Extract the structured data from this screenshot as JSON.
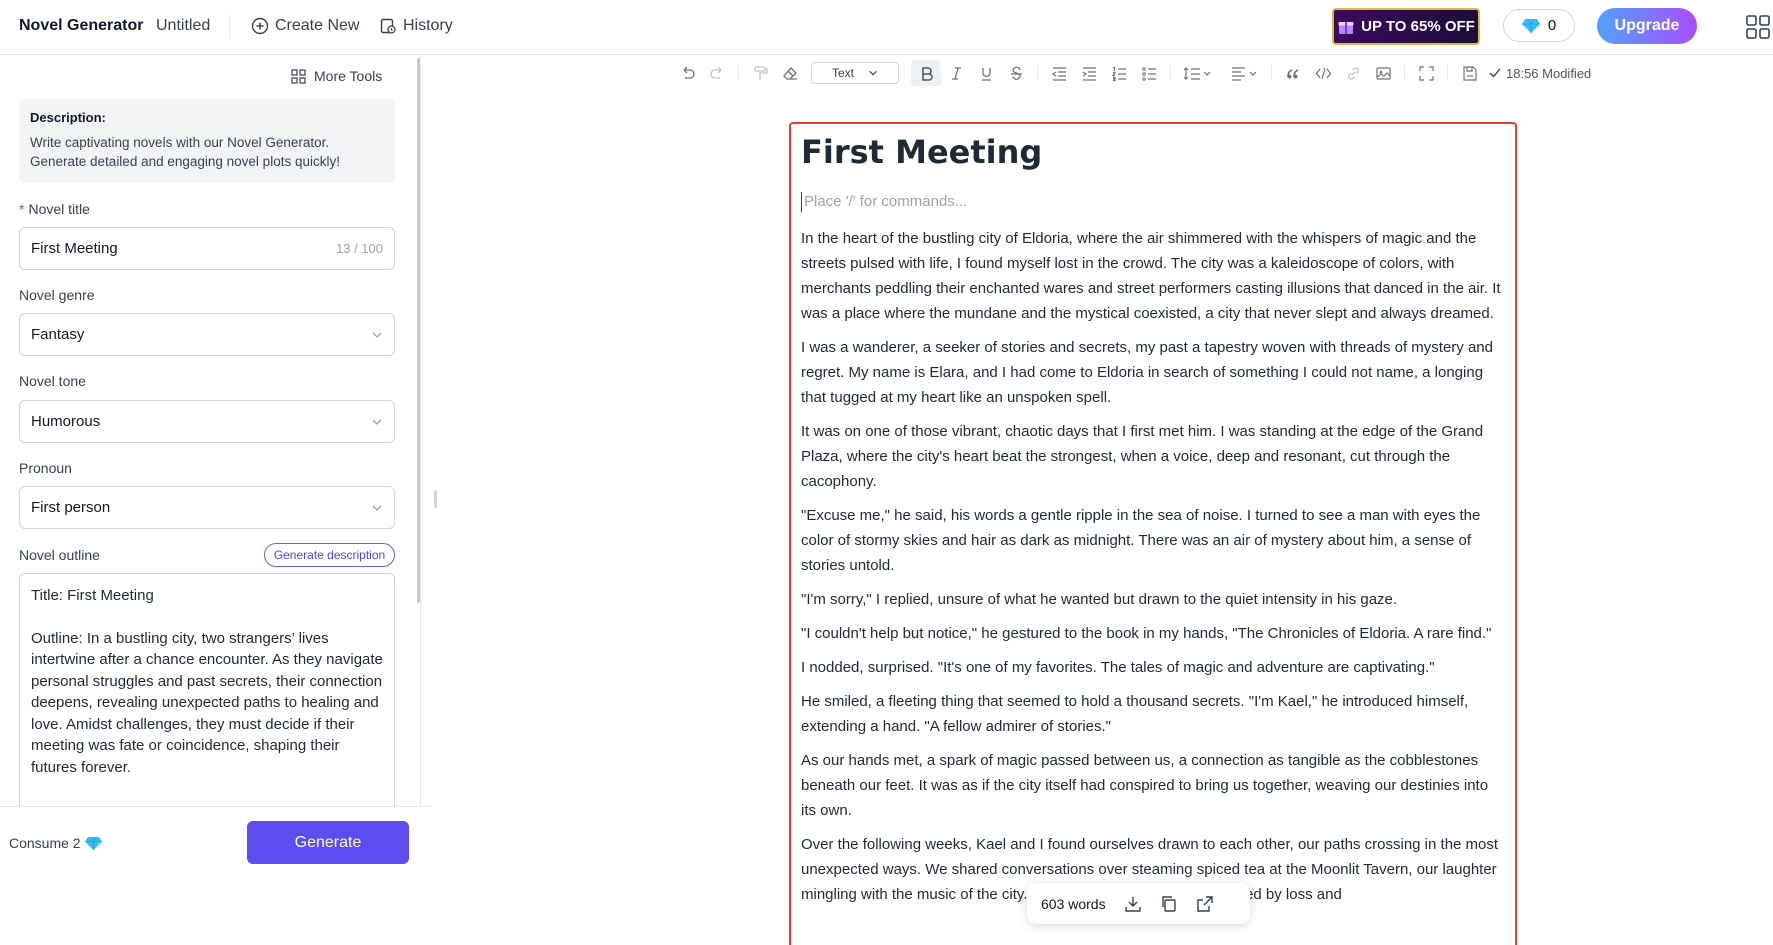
{
  "topbar": {
    "brand": "Novel Generator",
    "doc_name": "Untitled",
    "create_new": "Create New",
    "history": "History",
    "promo": "UP TO 65% OFF",
    "gems": "0",
    "upgrade": "Upgrade"
  },
  "left": {
    "more_tools": "More Tools",
    "description_title": "Description:",
    "description_text": "Write captivating novels with our Novel Generator. Generate detailed and engaging novel plots quickly!",
    "novel_title_label": "Novel title",
    "novel_title_value": "First Meeting",
    "novel_title_count": "13 / 100",
    "genre_label": "Novel genre",
    "genre_value": "Fantasy",
    "tone_label": "Novel tone",
    "tone_value": "Humorous",
    "pronoun_label": "Pronoun",
    "pronoun_value": "First person",
    "outline_label": "Novel outline",
    "generate_description": "Generate description",
    "outline_title": "Title: First Meeting",
    "outline_text": "Outline: In a bustling city, two strangers’ lives intertwine after a chance encounter. As they navigate personal struggles and past secrets, their connection deepens, revealing unexpected paths to healing and love. Amidst challenges, they must decide if their meeting was fate or coincidence, shaping their futures forever.",
    "consume": "Consume 2",
    "generate": "Generate"
  },
  "toolbar": {
    "text_style": "Text",
    "modified": "18:56 Modified"
  },
  "doc": {
    "title": "First Meeting",
    "placeholder": "Place '/' for commands...",
    "paragraphs": [
      "In the heart of the bustling city of Eldoria, where the air shimmered with the whispers of magic and the streets pulsed with life, I found myself lost in the crowd. The city was a kaleidoscope of colors, with merchants peddling their enchanted wares and street performers casting illusions that danced in the air. It was a place where the mundane and the mystical coexisted, a city that never slept and always dreamed.",
      "I was a wanderer, a seeker of stories and secrets, my past a tapestry woven with threads of mystery and regret. My name is Elara, and I had come to Eldoria in search of something I could not name, a longing that tugged at my heart like an unspoken spell.",
      "It was on one of those vibrant, chaotic days that I first met him. I was standing at the edge of the Grand Plaza, where the city's heart beat the strongest, when a voice, deep and resonant, cut through the cacophony.",
      "\"Excuse me,\" he said, his words a gentle ripple in the sea of noise. I turned to see a man with eyes the color of stormy skies and hair as dark as midnight. There was an air of mystery about him, a sense of stories untold.",
      "\"I'm sorry,\" I replied, unsure of what he wanted but drawn to the quiet intensity in his gaze.",
      "\"I couldn't help but notice,\" he gestured to the book in my hands, \"The Chronicles of Eldoria. A rare find.\"",
      "I nodded, surprised. \"It's one of my favorites. The tales of magic and adventure are captivating.\"",
      "He smiled, a fleeting thing that seemed to hold a thousand secrets. \"I'm Kael,\" he introduced himself, extending a hand. \"A fellow admirer of stories.\"",
      "As our hands met, a spark of magic passed between us, a connection as tangible as the cobblestones beneath our feet. It was as if the city itself had conspired to bring us together, weaving our destinies into its own.",
      "Over the following weeks, Kael and I found ourselves drawn to each other, our paths crossing in the most unexpected ways. We shared conversations over steaming spiced tea at the Moonlit Tavern, our laughter mingling with the music of the city. He spoke of his past, a life marked by loss and"
    ],
    "word_count": "603 words"
  }
}
